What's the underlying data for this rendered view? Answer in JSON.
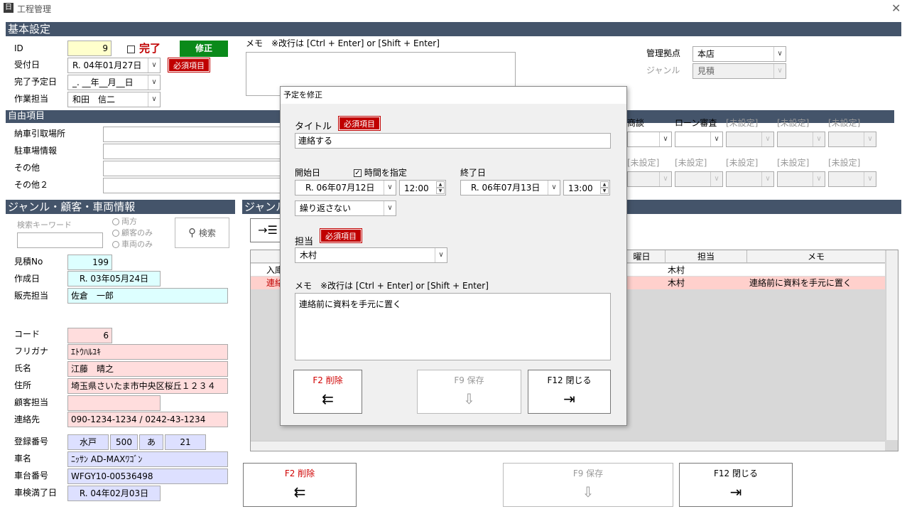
{
  "window": {
    "title": "工程管理",
    "icon": "app-icon",
    "icon_text": "日",
    "close": "✕"
  },
  "basic": {
    "header": "基本設定",
    "id_label": "ID",
    "id_value": "9",
    "complete_label": "完了",
    "edit_button": "修正",
    "received_label": "受付日",
    "received_value": "R. 04年01月27日",
    "required": "必須項目",
    "due_label": "完了予定日",
    "due_value": "_. __年__月__日",
    "worker_label": "作業担当",
    "worker_value": "和田　信二",
    "memo_label": "メモ　※改行は [Ctrl + Enter] or [Shift + Enter]",
    "base_label": "管理拠点",
    "base_value": "本店",
    "genre_label": "ジャンル",
    "genre_value": "見積"
  },
  "free": {
    "header": "自由項目",
    "rows": [
      {
        "label": "納車引取場所"
      },
      {
        "label": "駐車場情報"
      },
      {
        "label": "その他"
      },
      {
        "label": "その他２"
      }
    ],
    "cols_top": [
      "商談",
      "ローン審査",
      "[未設定]",
      "[未設定]",
      "[未設定]"
    ],
    "cols_bottom": [
      "[未設定]",
      "[未設定]",
      "[未設定]",
      "[未設定]",
      "[未設定]"
    ]
  },
  "customer": {
    "header": "ジャンル・顧客・車両情報",
    "search_label": "検索キーワード",
    "radio_both": "両方",
    "radio_customer": "顧客のみ",
    "radio_vehicle": "車両のみ",
    "search_button": "検索",
    "estimate_label": "見積No",
    "estimate_value": "199",
    "created_label": "作成日",
    "created_value": "R. 03年05月24日",
    "sales_label": "販売担当",
    "sales_value": "佐倉　一郎",
    "code_label": "コード",
    "code_value": "6",
    "kana_label": "フリガナ",
    "kana_value": "ｴﾄｳﾊﾙﾕｷ",
    "name_label": "氏名",
    "name_value": "江藤　晴之",
    "address_label": "住所",
    "address_value": "埼玉県さいたま市中央区桜丘１２３４",
    "cust_staff_label": "顧客担当",
    "cust_staff_value": "",
    "contact_label": "連絡先",
    "contact_value": "090-1234-1234 / 0242-43-1234",
    "reg_label": "登録番号",
    "reg_values": [
      "水戸",
      "500",
      "あ",
      "21"
    ],
    "car_label": "車名",
    "car_value": "ﾆｯｻﾝ AD-MAXﾜｺﾞﾝ",
    "chassis_label": "車台番号",
    "chassis_value": "WFGY10-00536498",
    "inspect_label": "車検満了日",
    "inspect_value": "R. 04年02月03日"
  },
  "schedule": {
    "header": "ジャンル",
    "table_headers": [
      "曜日",
      "担当",
      "メモ"
    ],
    "rows": [
      {
        "title": "入庫",
        "staff": "木村",
        "memo": ""
      },
      {
        "title": "連絡",
        "staff": "木村",
        "memo": "連絡前に資料を手元に置く"
      }
    ]
  },
  "footer": {
    "delete_label": "F2 削除",
    "delete_icon": "⇇",
    "save_label": "F9 保存",
    "save_icon": "⇩",
    "close_label": "F12 閉じる",
    "close_icon": "⇥"
  },
  "modal": {
    "title": "予定を修正",
    "title_label": "タイトル",
    "title_value": "連絡する",
    "required": "必須項目",
    "start_label": "開始日",
    "time_check_label": "時間を指定",
    "start_date": "R. 06年07月12日",
    "start_time": "12:00",
    "end_label": "終了日",
    "end_date": "R. 06年07月13日",
    "end_time": "13:00",
    "repeat_value": "繰り返さない",
    "staff_label": "担当",
    "staff_value": "木村",
    "memo_label": "メモ　※改行は [Ctrl + Enter] or [Shift + Enter]",
    "memo_value": "連絡前に資料を手元に置く",
    "delete_label": "F2 削除",
    "save_label": "F9 保存",
    "close_label": "F12 閉じる"
  }
}
